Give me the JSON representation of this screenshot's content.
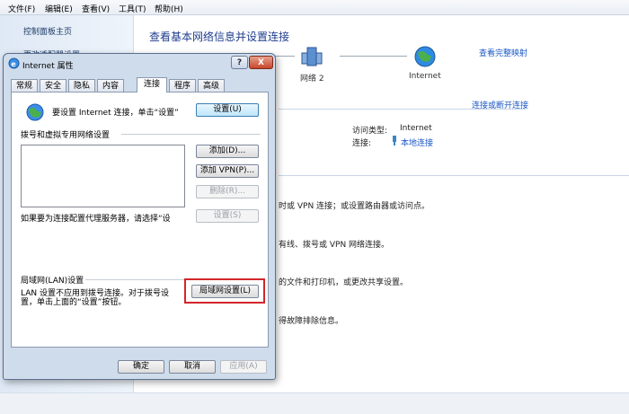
{
  "menubar": {
    "items": [
      "文件(F)",
      "编辑(E)",
      "查看(V)",
      "工具(T)",
      "帮助(H)"
    ]
  },
  "left_pane": {
    "items": [
      "控制面板主页",
      "更改适配器设置"
    ]
  },
  "main": {
    "title": "查看基本网络信息并设置连接",
    "full_map_link": "查看完整映射",
    "network_nodes": [
      "网络 2",
      "Internet"
    ],
    "connect_disconnect_link": "连接或断开连接",
    "access_type_label": "访问类型:",
    "access_type_value": "Internet",
    "connection_label": "连接:",
    "connection_value": "本地连接",
    "tasks": [
      "时或 VPN 连接；或设置路由器或访问点。",
      "有线、拨号或 VPN 网络连接。",
      "的文件和打印机，或更改共享设置。",
      "得故障排除信息。"
    ]
  },
  "dialog": {
    "title": "Internet 属性",
    "help_symbol": "?",
    "close_symbol": "X",
    "tabs": [
      "常规",
      "安全",
      "隐私",
      "内容",
      "连接",
      "程序",
      "高级"
    ],
    "active_tab": "连接",
    "setup_text": "要设置 Internet 连接，单击“设置”",
    "setup_button": "设置(U)",
    "dialup_group_label": "拨号和虚拟专用网络设置",
    "add_button": "添加(D)...",
    "add_vpn_button": "添加 VPN(P)...",
    "remove_button": "删除(R)...",
    "proxy_text": "如果要为连接配置代理服务器，请选择“设",
    "settings_button": "设置(S)",
    "lan_group_label": "局域网(LAN)设置",
    "lan_text_1": "LAN 设置不应用到拨号连接。对于拨号设",
    "lan_text_2": "置，单击上面的“设置”按钮。",
    "lan_settings_button": "局域网设置(L)",
    "ok_button": "确定",
    "cancel_button": "取消",
    "apply_button": "应用(A)"
  }
}
